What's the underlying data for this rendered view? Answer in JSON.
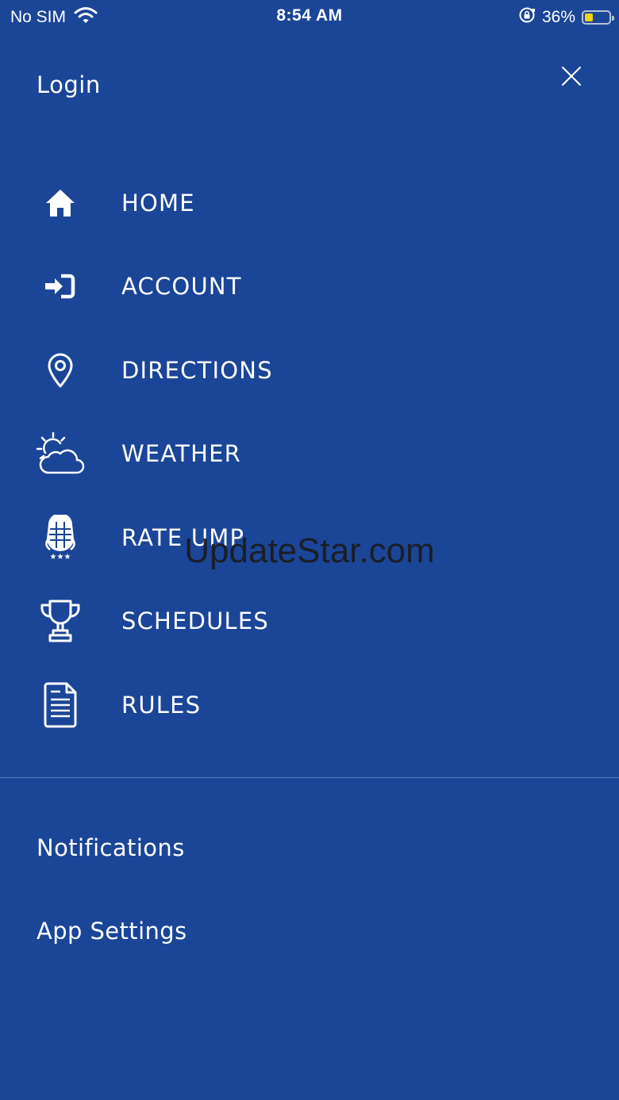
{
  "status_bar": {
    "carrier": "No SIM",
    "time": "8:54 AM",
    "battery_percent": "36%",
    "battery_level": 0.36,
    "icons": [
      "wifi-icon",
      "rotation-lock-icon",
      "battery-icon"
    ]
  },
  "header": {
    "login_label": "Login",
    "close_icon": "close-icon"
  },
  "menu": {
    "items": [
      {
        "label": "HOME",
        "icon": "home-icon"
      },
      {
        "label": "ACCOUNT",
        "icon": "sign-in-icon"
      },
      {
        "label": "DIRECTIONS",
        "icon": "map-pin-icon"
      },
      {
        "label": "WEATHER",
        "icon": "partly-cloudy-icon"
      },
      {
        "label": "RATE UMP",
        "icon": "umpire-mask-icon"
      },
      {
        "label": "SCHEDULES",
        "icon": "trophy-icon"
      },
      {
        "label": "RULES",
        "icon": "document-icon"
      }
    ]
  },
  "secondary": {
    "notifications_label": "Notifications",
    "app_settings_label": "App Settings"
  },
  "watermark": "UpdateStar.com",
  "colors": {
    "background": "#1b4597",
    "text": "#ffffff",
    "battery": "#f5d20a"
  }
}
